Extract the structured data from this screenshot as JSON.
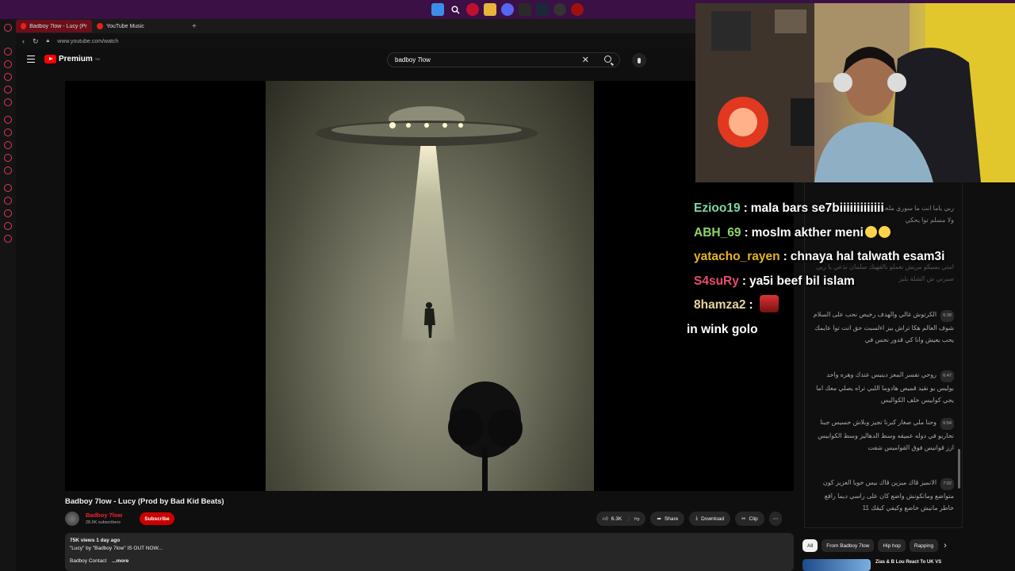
{
  "browser": {
    "tabs": [
      {
        "label": "Badboy 7low - Lucy (Prod",
        "active": true
      },
      {
        "label": "YouTube Music",
        "active": false
      }
    ],
    "url": "www.youtube.com/watch"
  },
  "header": {
    "logo_text": "Premium",
    "logo_sup": "TM",
    "search_value": "badboy 7low"
  },
  "video": {
    "title": "Badboy 7low - Lucy (Prod by Bad Kid Beats)",
    "channel": "Badboy 7low",
    "subscribers": "28.6K subscribers",
    "subscribe_label": "Subscribe",
    "likes": "6.3K",
    "share_label": "Share",
    "download_label": "Download",
    "clip_label": "Clip",
    "more_label": "⋯",
    "views_date": "75K views  1 day ago",
    "desc_line": "\"Lucy\" by \"Badboy 7low\" IS OUT NOW...",
    "desc_contact": "Badboy Contact",
    "desc_more": "...more"
  },
  "lyrics": [
    {
      "ts": "",
      "text": "ربي ياما انت ما سوري ملحد ولا يغني عنده مديده ملي ولا مسلم توا يحكي"
    },
    {
      "ts": "",
      "text": "امتي بسيكو مريش نعملو بالفهيك سلمان نذعي يا ربي صبرني ش الشلة بليز"
    },
    {
      "ts": "6:39",
      "text": "الكرتوش غالي والهدف رخيص نحب على السلام شوف العالم هكا تراش بيز اءلسبت حق انت توا عايمك يحب يعيش وانا كي قدور نحس في"
    },
    {
      "ts": "6:47",
      "text": "روحي نفسر المعز دينيس عندك وهره واحد بوليس يو نقيد قميص هادوما اللبي تراه يصلي معك اما يجي كوابيس خلف الكواليس"
    },
    {
      "ts": "6:54",
      "text": "وحنا ملي صغار كبرنا تجيز وبلاش حسيس جبنا نحاربو في دوله عميقه وسط الدهاليز وسط الكوابيس ازز قوانيس فوق القواميس شفت"
    },
    {
      "ts": "7:02",
      "text": "الانميز ڤاك ميزين ڤاك بيس خويا العزيز كون متواضع وماتكونش واضع كان على راسي ديما رافع خاطر مانيش خاضع وكيفي كيڤك 11"
    }
  ],
  "chips": [
    {
      "label": "All",
      "selected": true
    },
    {
      "label": "From Badboy 7low",
      "selected": false
    },
    {
      "label": "Hip hop",
      "selected": false
    },
    {
      "label": "Rapping",
      "selected": false
    }
  ],
  "recommended": {
    "title": "Zias & B Lou React To UK VS"
  },
  "overlay_chat": [
    {
      "user": "Ezioo19",
      "color": "#7ed7a4",
      "text": "mala bars se7biiiiiiiiiiiii",
      "extra": ""
    },
    {
      "user": "ABH_69",
      "color": "#8fd46a",
      "text": "moslm akther meni",
      "extra": "emoji"
    },
    {
      "user": "yatacho_rayen",
      "color": "#e8b422",
      "text": "chnaya hal talwath esam3i",
      "extra": ""
    },
    {
      "user": "S4suRy",
      "color": "#e84c6c",
      "text": "ya5i beef bil islam",
      "extra": ""
    },
    {
      "user": "8hamza2",
      "color": "#e8d4a0",
      "text": "",
      "extra": "emote"
    }
  ],
  "overlay_tail": "in wink golo",
  "colors": {
    "accent": "#cc0000",
    "background": "#0f0f0f",
    "chip": "#272727"
  }
}
